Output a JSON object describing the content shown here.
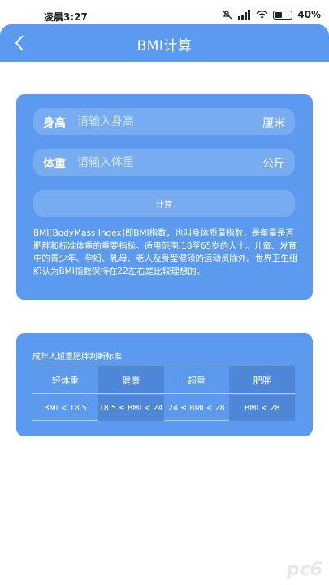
{
  "status_bar": {
    "time": "凌晨3:27",
    "battery": "40"
  },
  "header": {
    "title": "BMI计算",
    "back_icon": "chevron-left-icon"
  },
  "form": {
    "height": {
      "label": "身高",
      "placeholder": "请输入身高",
      "unit": "厘米"
    },
    "weight": {
      "label": "体重",
      "placeholder": "请输入体重",
      "unit": "公斤"
    },
    "calculate_label": "计算"
  },
  "description": "BMI[BodyMass Index]即BMI指数，也叫身体质量指数，是衡量是否肥胖和标准体重的重要指标。适用范围:18至65岁的人士。儿童、发育中的青少年、孕妇、乳母、老人及身型健硕的运动员除外。世界卫生组织认为BMI指数保持在22左右是比较理想的。",
  "standards": {
    "heading": "成年人超重肥胖判断标准",
    "columns": [
      "轻体重",
      "健康",
      "超重",
      "肥胖"
    ],
    "values": [
      "BMI < 18.5",
      "18.5 ≤ BMI < 24",
      "24 ≤ BMI < 28",
      "BMI < 28"
    ]
  },
  "colors": {
    "primary": "#5b9aee",
    "dark_column": "#4e87d8",
    "background": "#ffffff"
  }
}
